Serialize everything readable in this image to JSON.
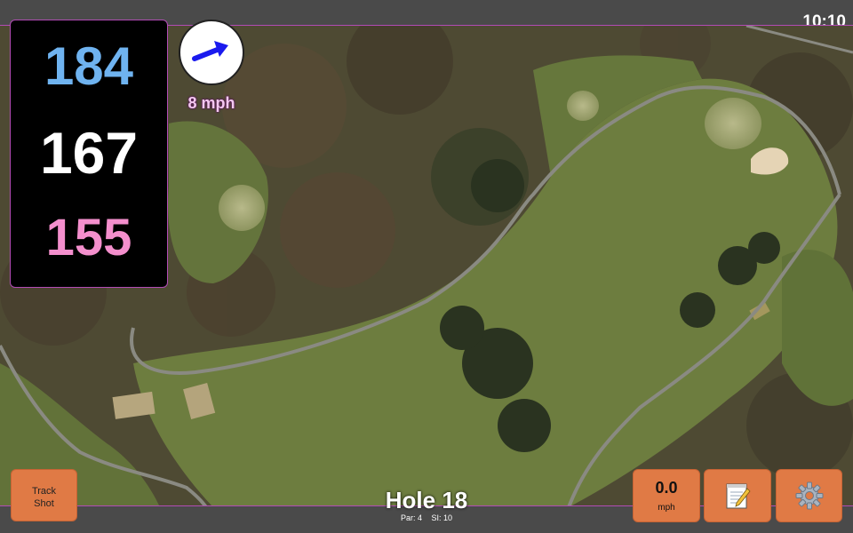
{
  "status": {
    "time": "10:10"
  },
  "distances": {
    "back": "184",
    "middle": "167",
    "front": "155"
  },
  "wind": {
    "speed_label": "8 mph",
    "arrow_icon": "wind-arrow-icon"
  },
  "hole": {
    "title": "Hole 18",
    "par": "Par: 4",
    "si": "SI: 10"
  },
  "buttons": {
    "track_shot_line1": "Track",
    "track_shot_line2": "Shot",
    "speed_value": "0.0",
    "speed_unit": "mph",
    "notes_icon": "notepad-icon",
    "settings_icon": "gear-icon"
  },
  "colors": {
    "back_distance": "#6fb3f0",
    "middle_distance": "#ffffff",
    "front_distance": "#f48fcd",
    "button": "#e07a45",
    "accent_border": "#b24bb5"
  }
}
